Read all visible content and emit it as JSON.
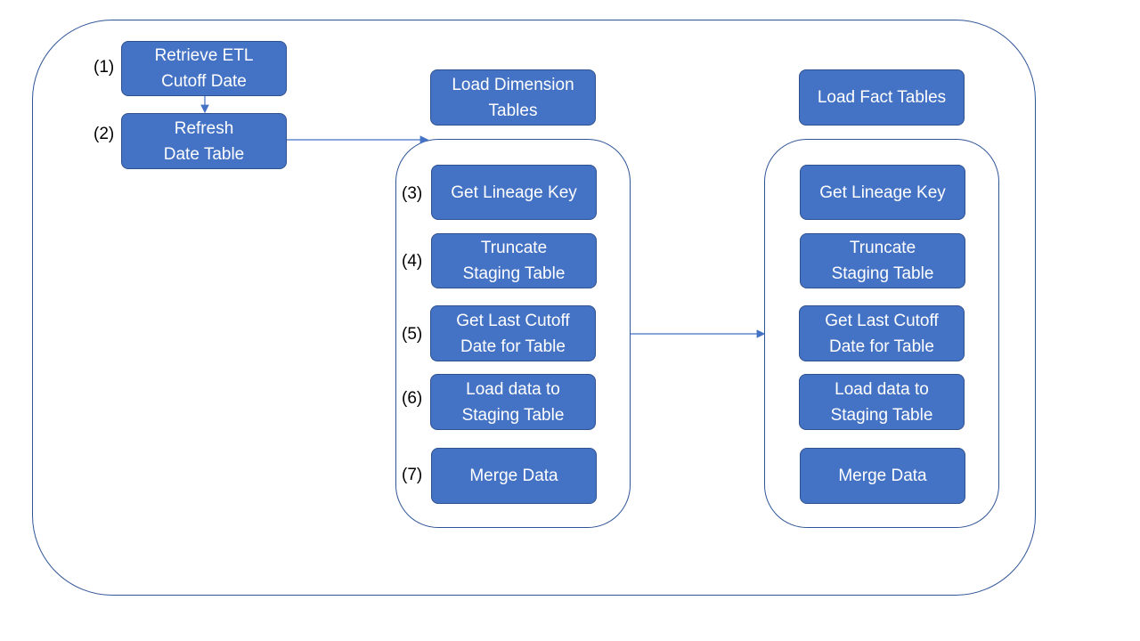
{
  "diagram": {
    "start_steps": [
      {
        "number": "(1)",
        "label": "Retrieve ETL Cutoff Date"
      },
      {
        "number": "(2)",
        "label": "Refresh Date Table"
      }
    ],
    "dimension": {
      "title": "Load Dimension Tables",
      "steps": [
        {
          "number": "(3)",
          "label": "Get Lineage Key"
        },
        {
          "number": "(4)",
          "label": "Truncate Staging Table"
        },
        {
          "number": "(5)",
          "label": "Get Last Cutoff Date for Table"
        },
        {
          "number": "(6)",
          "label": "Load data to Staging Table"
        },
        {
          "number": "(7)",
          "label": "Merge Data"
        }
      ]
    },
    "fact": {
      "title": "Load Fact Tables",
      "steps": [
        {
          "label": "Get Lineage Key"
        },
        {
          "label": "Truncate Staging Table"
        },
        {
          "label": "Get Last Cutoff Date for Table"
        },
        {
          "label": "Load data to Staging Table"
        },
        {
          "label": "Merge Data"
        }
      ]
    },
    "colors": {
      "box_fill": "#4472c4",
      "box_border": "#2f528f",
      "line": "#4472c4",
      "frame": "#2f5597"
    }
  }
}
